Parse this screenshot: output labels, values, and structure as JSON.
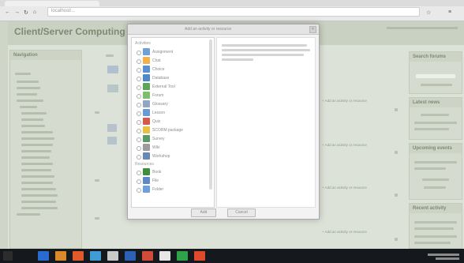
{
  "browser": {
    "url": "localhost/..."
  },
  "site": {
    "title": "Client/Server Computing"
  },
  "modal": {
    "title": "Add an activity or resource",
    "activities_section": "Activities",
    "resources_section": "Resources",
    "activities": [
      {
        "label": "Assignment",
        "color": "#6fa0d8"
      },
      {
        "label": "Chat",
        "color": "#f2b14a"
      },
      {
        "label": "Choice",
        "color": "#5a8fd1"
      },
      {
        "label": "Database",
        "color": "#4f88c7"
      },
      {
        "label": "External Tool",
        "color": "#59a657"
      },
      {
        "label": "Forum",
        "color": "#7fbf6a"
      },
      {
        "label": "Glossary",
        "color": "#8fa7c4"
      },
      {
        "label": "Lesson",
        "color": "#6a9ad6"
      },
      {
        "label": "Quiz",
        "color": "#d55a4a"
      },
      {
        "label": "SCORM package",
        "color": "#e8c043"
      },
      {
        "label": "Survey",
        "color": "#5a9a66"
      },
      {
        "label": "Wiki",
        "color": "#9b9b9b"
      },
      {
        "label": "Workshop",
        "color": "#6888b8"
      }
    ],
    "resources": [
      {
        "label": "Book",
        "color": "#3d8f3d"
      },
      {
        "label": "File",
        "color": "#5e87c8"
      },
      {
        "label": "Folder",
        "color": "#6e9edb"
      }
    ],
    "add_label": "Add",
    "cancel_label": "Cancel"
  },
  "sidebar": {
    "navigation_title": "Navigation"
  },
  "right": {
    "blocks": [
      {
        "title": "Search forums"
      },
      {
        "title": "Latest news"
      },
      {
        "title": "Upcoming events"
      },
      {
        "title": "Recent activity"
      }
    ]
  },
  "center": {
    "row_links": [
      "+ Add an activity or resource",
      "+ Add an activity or resource",
      "+ Add an activity or resource",
      "+ Add an activity or resource"
    ]
  },
  "taskbar": {
    "colors": [
      "#2a6bd1",
      "#d98b2b",
      "#e05a2c",
      "#3f9dd6",
      "#c9c9c9",
      "#2b62b8",
      "#d24a3a",
      "#e6e6e6",
      "#2fa34a",
      "#e04a2c"
    ]
  }
}
